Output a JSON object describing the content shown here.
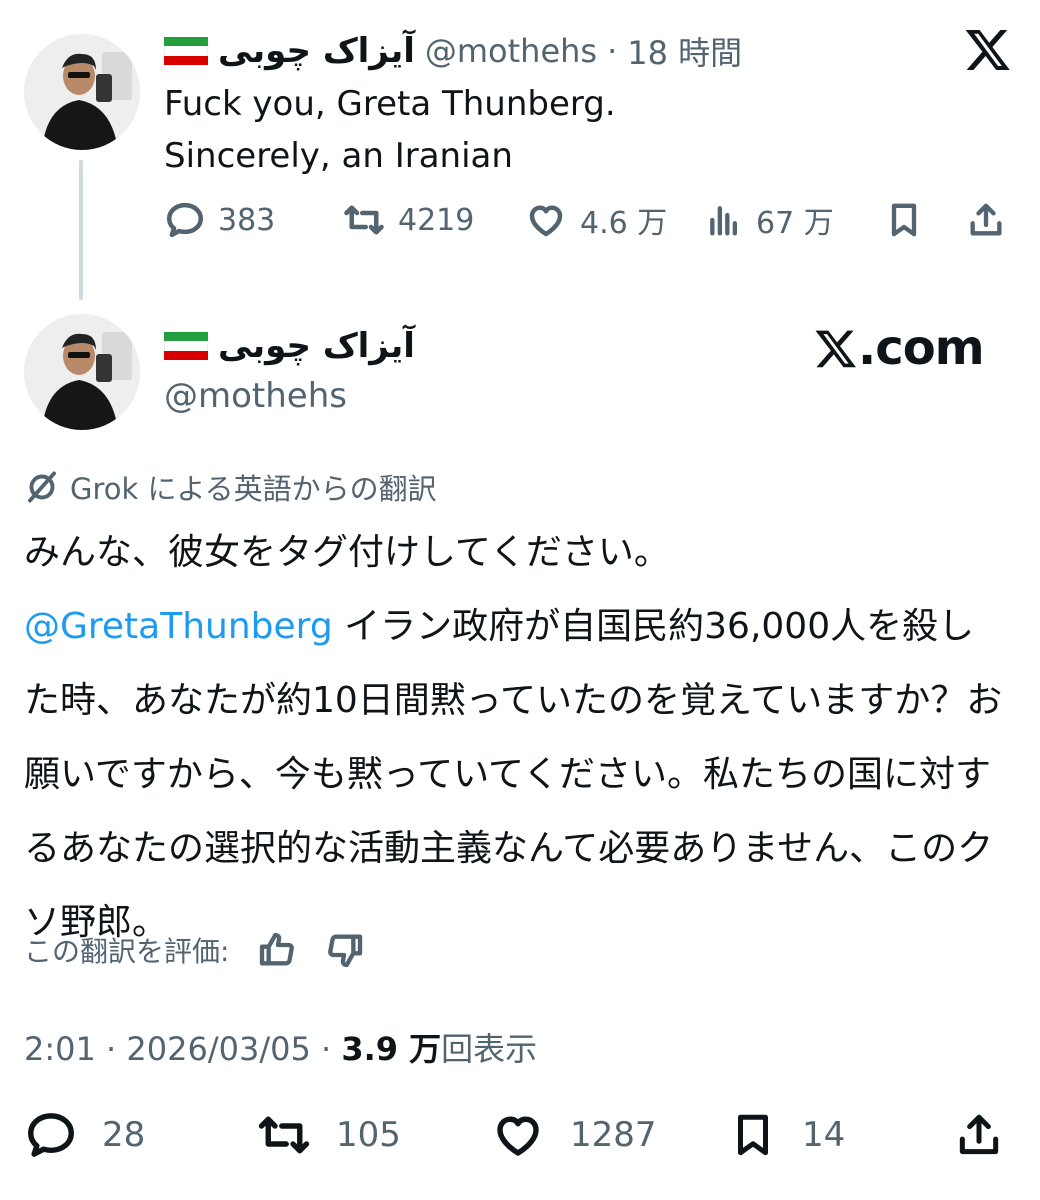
{
  "original": {
    "display_name": "آیزاک چوبی",
    "handle": "@mothehs",
    "separator": "·",
    "time_ago": "18 時間",
    "text_lines": [
      "Fuck you, Greta Thunberg.",
      "Sincerely, an Iranian"
    ],
    "stats": {
      "replies": "383",
      "reposts": "4219",
      "likes": "4.6 万",
      "views": "67 万"
    }
  },
  "quoted": {
    "display_name": "آیزاک چوبی",
    "handle": "@mothehs",
    "watermark": "X.com",
    "translation_label": "Grok による英語からの翻訳",
    "text_line1": "みんな、彼女をタグ付けしてください。",
    "mention": "@GretaThunberg",
    "text_body": " イラン政府が自国民約36,000人を殺した時、あなたが約10日間黙っていたのを覚えていますか？お願いですから、今も黙っていてください。私たちの国に対するあなたの選択的な活動主義なんて必要ありません、このクソ野郎。",
    "rate_label": "この翻訳を評価:",
    "time": "2:01",
    "date": "2026/03/05",
    "separator": "·",
    "views_count": "3.9 万",
    "views_label": "回表示",
    "actions": {
      "replies": "28",
      "reposts": "105",
      "likes": "1287",
      "bookmarks": "14"
    }
  },
  "flag_colors": {
    "green": "#239f40",
    "white": "#ffffff",
    "red": "#da0000"
  }
}
